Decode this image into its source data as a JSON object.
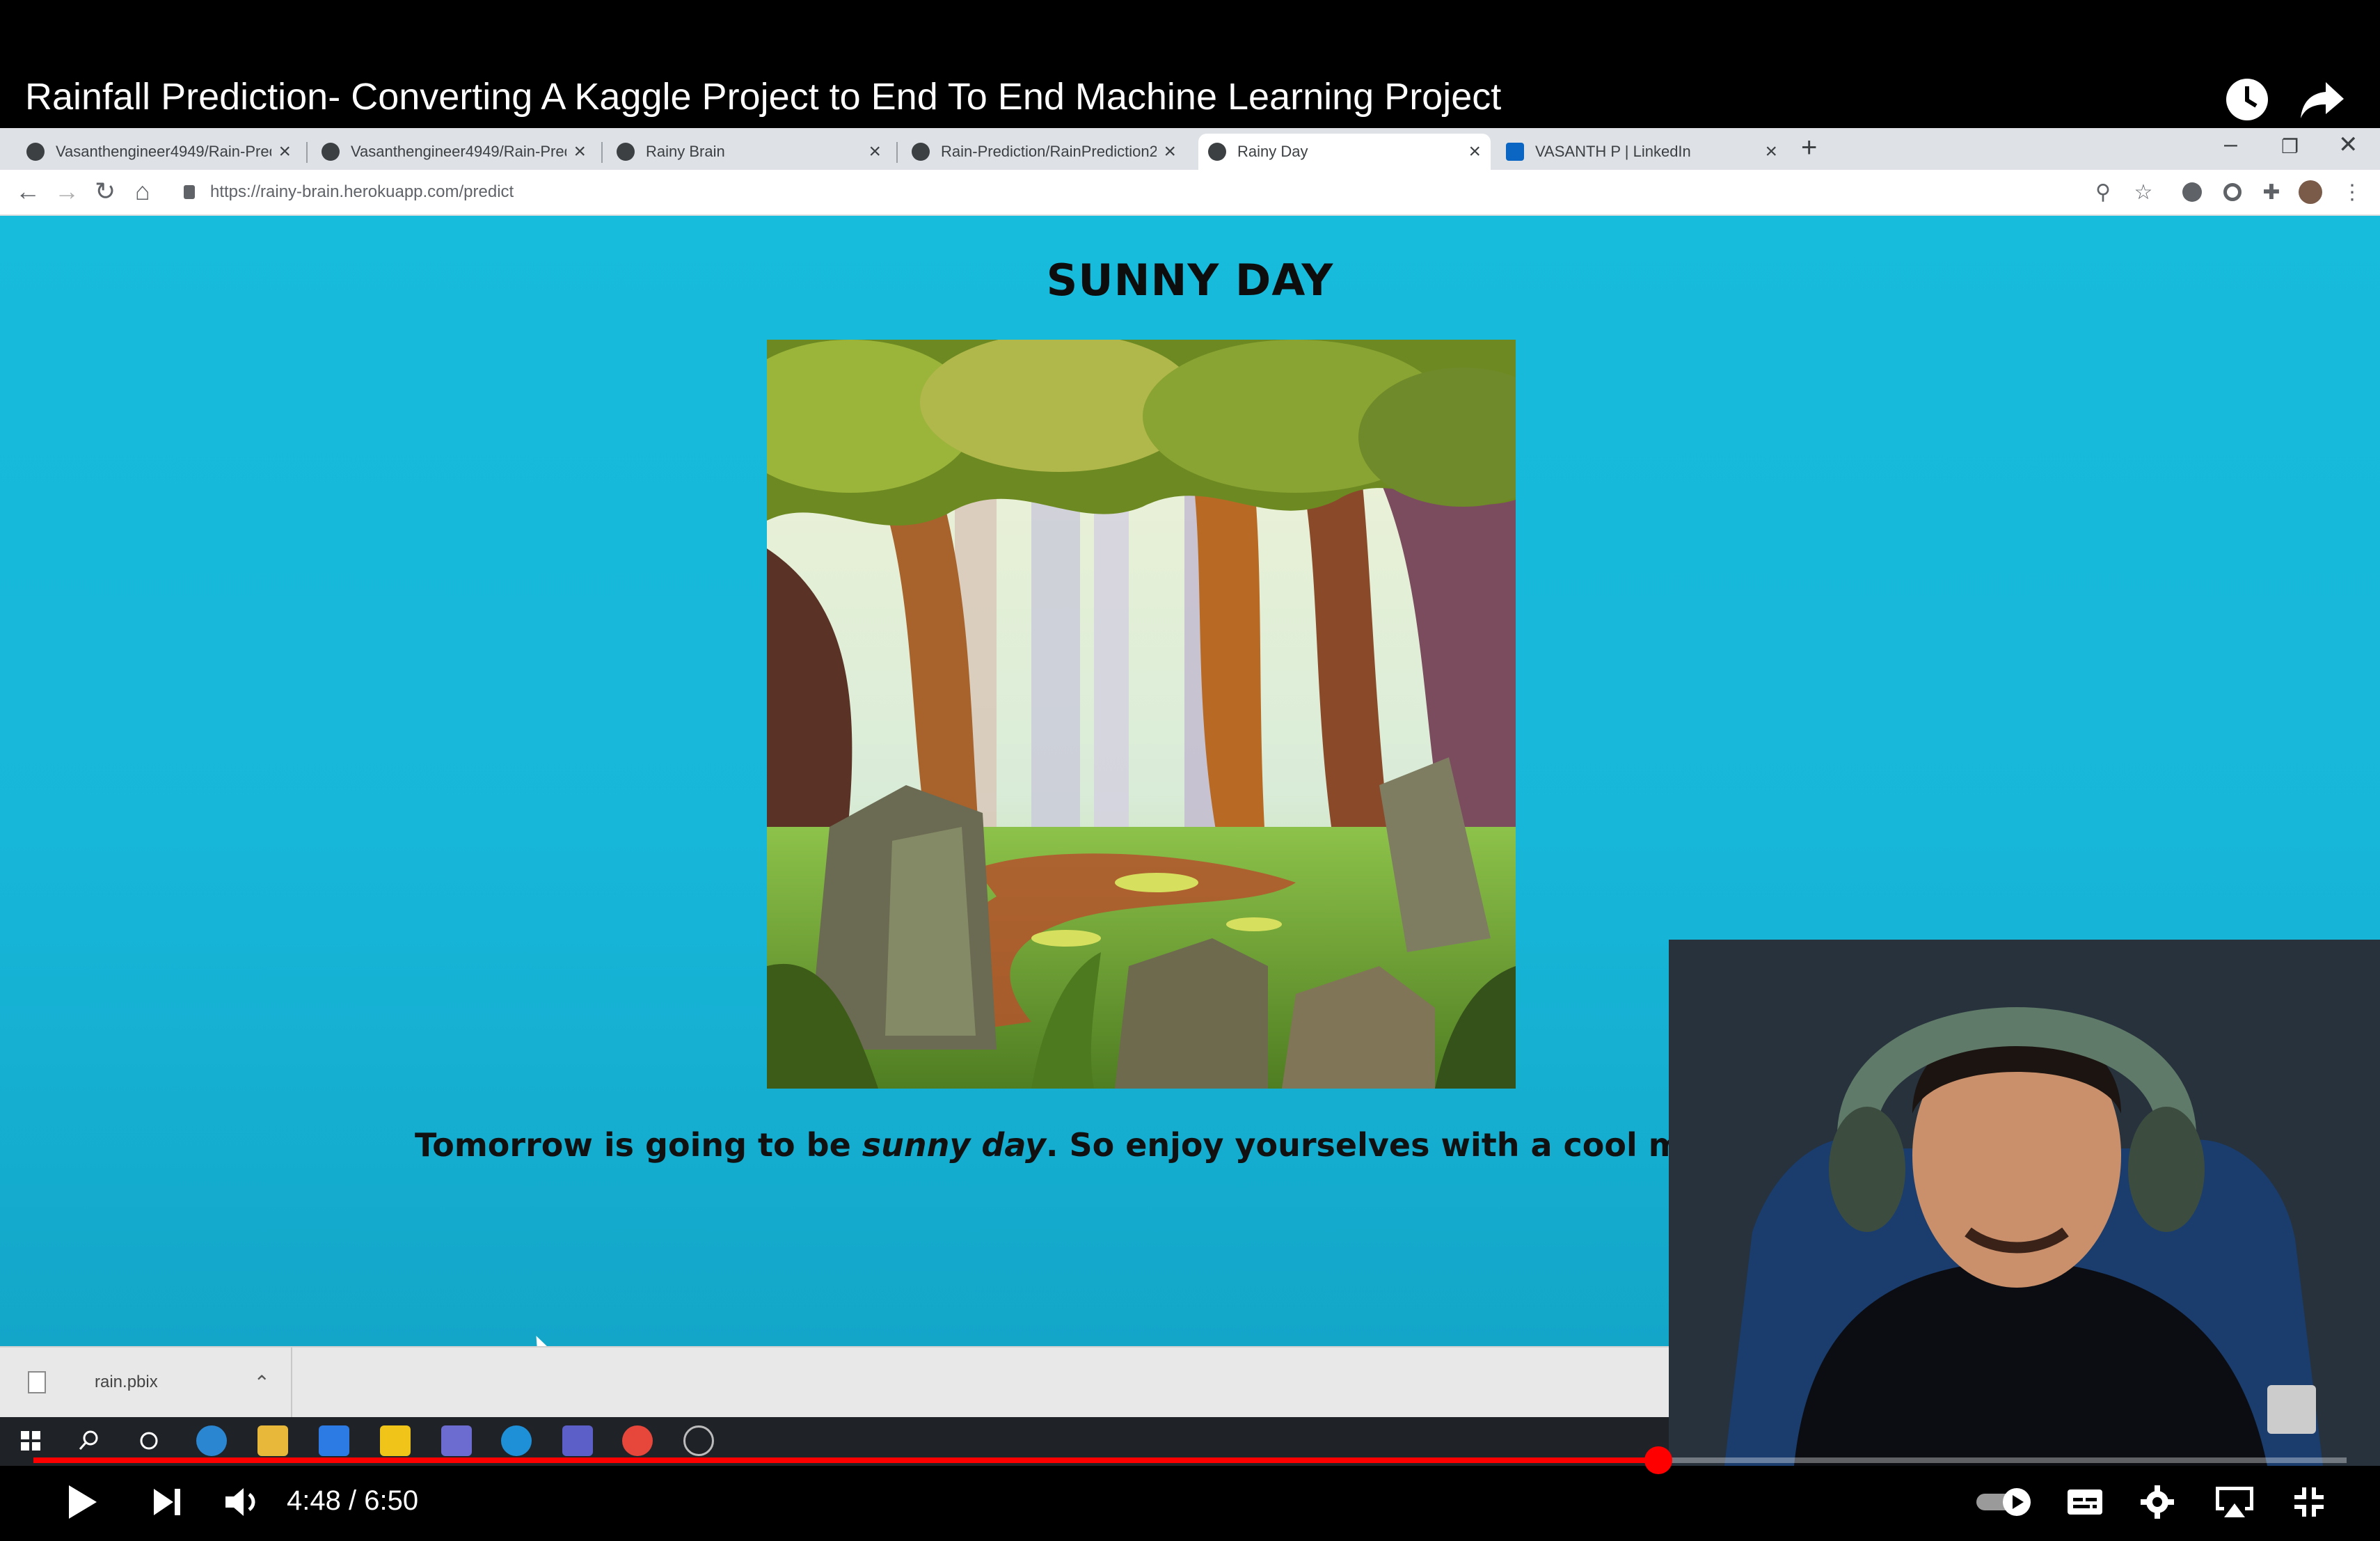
{
  "video": {
    "title": "Rainfall Prediction- Converting A Kaggle Project to End To End Machine Learning Project",
    "current_time": "4:48",
    "separator": "/",
    "duration": "6:50",
    "progress_fraction": 0.7025
  },
  "browser": {
    "tabs": [
      {
        "label": "Vasanthengineer4949/Rain-Pred",
        "icon": "github-icon",
        "active": false
      },
      {
        "label": "Vasanthengineer4949/Rain-Pred",
        "icon": "github-icon",
        "active": false
      },
      {
        "label": "Rainy Brain",
        "icon": "globe-icon",
        "active": false
      },
      {
        "label": "Rain-Prediction/RainPrediction2",
        "icon": "github-icon",
        "active": false
      },
      {
        "label": "Rainy Day",
        "icon": "globe-icon",
        "active": true
      },
      {
        "label": "VASANTH P | LinkedIn",
        "icon": "linkedin-icon",
        "active": false
      }
    ],
    "url": "https://rainy-brain.herokuapp.com/predict"
  },
  "page": {
    "heading": "SUNNY DAY",
    "message_prefix": "Tomorrow is going to be ",
    "message_emphasis": "sunny day",
    "message_suffix": ". So enjoy yourselves with a cool milkshake and ic"
  },
  "download_bar": {
    "file_name": "rain.pbix"
  },
  "colors": {
    "page_background": "#17bbdb",
    "progress": "#ff0000",
    "heading_text": "#0d0d0d"
  }
}
